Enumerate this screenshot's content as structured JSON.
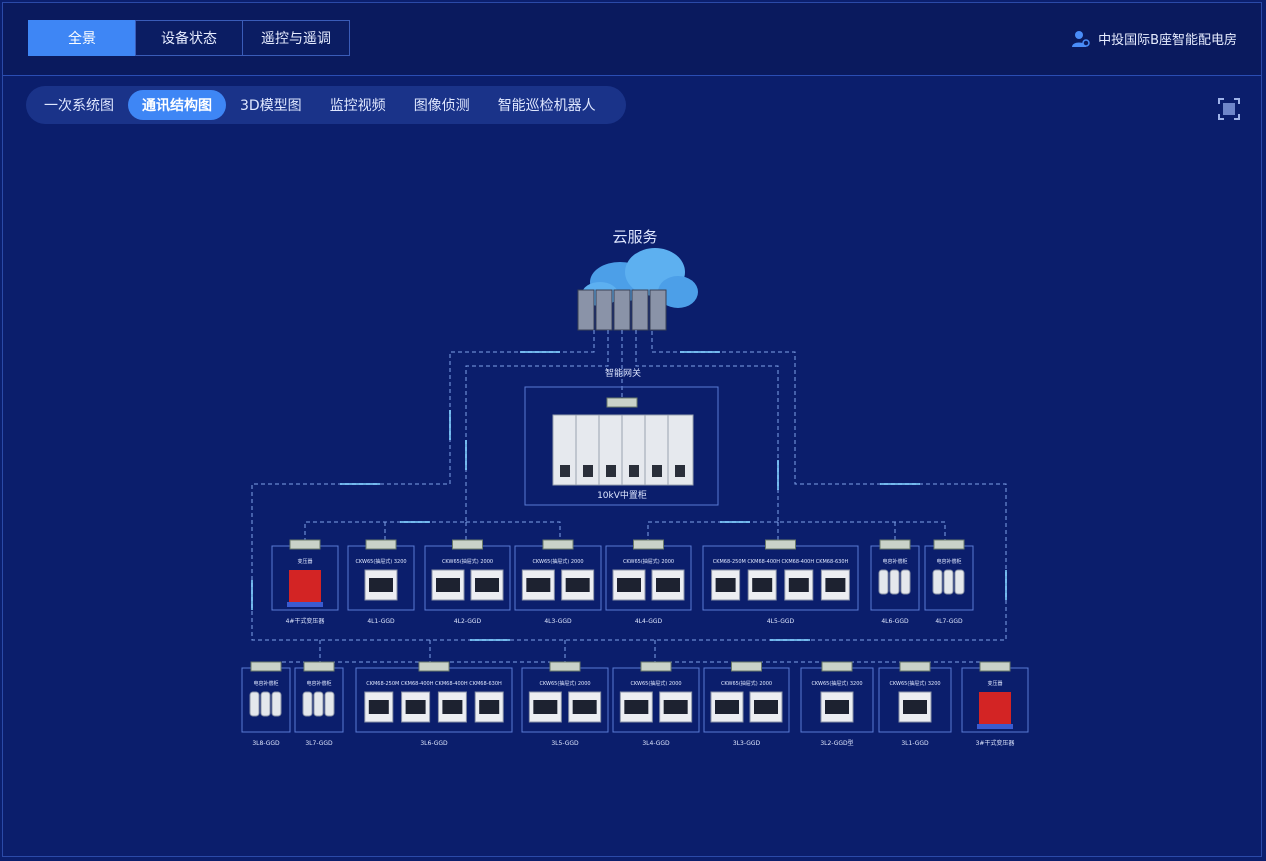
{
  "header": {
    "tabs": [
      {
        "label": "全景",
        "active": true
      },
      {
        "label": "设备状态",
        "active": false
      },
      {
        "label": "遥控与遥调",
        "active": false
      }
    ],
    "station": "中投国际B座智能配电房"
  },
  "subtabs": [
    {
      "label": "一次系统图",
      "active": false
    },
    {
      "label": "通讯结构图",
      "active": true
    },
    {
      "label": "3D模型图",
      "active": false
    },
    {
      "label": "监控视频",
      "active": false
    },
    {
      "label": "图像侦测",
      "active": false
    },
    {
      "label": "智能巡检机器人",
      "active": false
    }
  ],
  "diagram": {
    "cloud_label": "云服务",
    "gateway_label": "智能网关",
    "mv_cabinet_label": "10kV中置柜",
    "row1": [
      {
        "name": "4#干式变压器",
        "title": "变压器"
      },
      {
        "name": "4L1-GGD",
        "title": "CKW65(抽屉式) 3200"
      },
      {
        "name": "4L2-GGD",
        "title": "CKW65(抽屉式) 2000"
      },
      {
        "name": "4L3-GGD",
        "title": "CKW65(抽屉式) 2000"
      },
      {
        "name": "4L4-GGD",
        "title": "CKW65(抽屉式) 2000"
      },
      {
        "name": "4L5-GGD",
        "title": "CKM68-250M  CKM68-400H  CKM68-400H  CKM68-630H"
      },
      {
        "name": "4L6-GGD",
        "title": "电容补偿柜"
      },
      {
        "name": "4L7-GGD",
        "title": "电容补偿柜"
      }
    ],
    "row2": [
      {
        "name": "3L8-GGD",
        "title": "电容补偿柜"
      },
      {
        "name": "3L7-GGD",
        "title": "电容补偿柜"
      },
      {
        "name": "3L6-GGD",
        "title": "CKM68-250M  CKM68-400H  CKM68-400H  CKM68-630H"
      },
      {
        "name": "3L5-GGD",
        "title": "CKW65(抽屉式) 2000"
      },
      {
        "name": "3L4-GGD",
        "title": "CKW65(抽屉式) 2000"
      },
      {
        "name": "3L3-GGD",
        "title": "CKW65(抽屉式) 2000"
      },
      {
        "name": "3L2-GGD型",
        "title": "CKW65(抽屉式) 3200"
      },
      {
        "name": "3L1-GGD",
        "title": "CKW65(抽屉式) 3200"
      },
      {
        "name": "3#干式变压器",
        "title": "变压器"
      }
    ]
  }
}
